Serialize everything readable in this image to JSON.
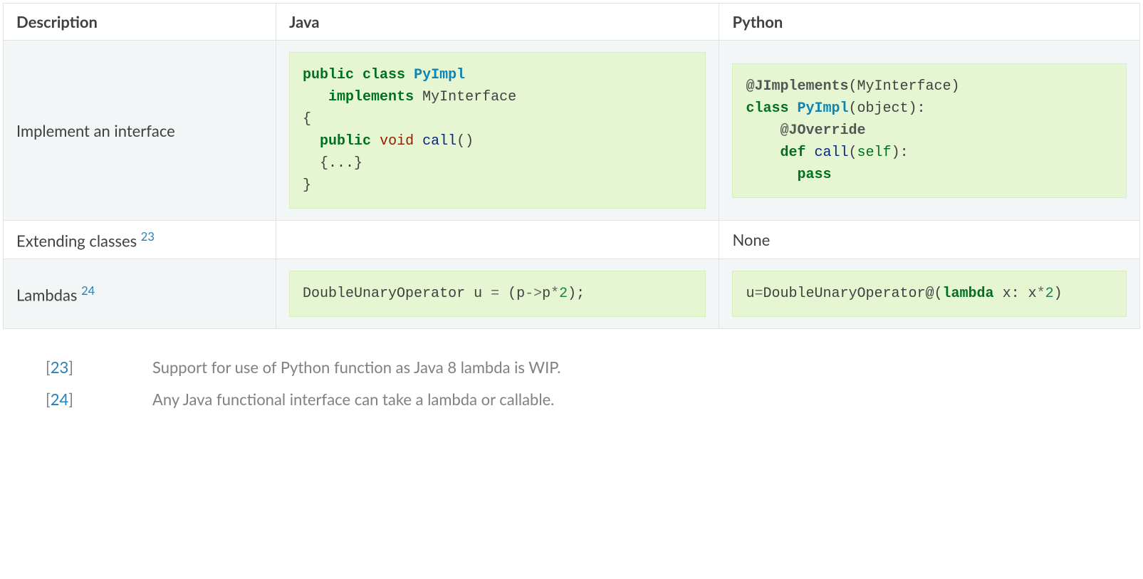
{
  "headers": {
    "description": "Description",
    "java": "Java",
    "python": "Python"
  },
  "rows": {
    "implement": {
      "desc": "Implement an interface",
      "java_code": {
        "line1_kd": "public class ",
        "line1_nc": "PyImpl",
        "line2_indent": "   ",
        "line2_kd": "implements",
        "line2_n": " MyInterface",
        "line3": "{",
        "line4_indent": "  ",
        "line4_kd": "public",
        "line4_sp": " ",
        "line4_kt": "void",
        "line4_sp2": " ",
        "line4_nf": "call",
        "line4_p": "()",
        "line5_indent": "  ",
        "line5": "{...}",
        "line6": "}"
      },
      "python_code": {
        "line1_nd": "@JImplements",
        "line1_p": "(MyInterface)",
        "line2_k": "class",
        "line2_sp": " ",
        "line2_nc": "PyImpl",
        "line2_p": "(object):",
        "line3_indent": "    ",
        "line3_nd": "@JOverride",
        "line4_indent": "    ",
        "line4_k": "def",
        "line4_sp": " ",
        "line4_nf": "call",
        "line4_p1": "(",
        "line4_bp": "self",
        "line4_p2": "):",
        "line5_indent": "      ",
        "line5_k": "pass"
      }
    },
    "extending": {
      "desc_text": "Extending classes ",
      "desc_ref": "23",
      "java": "",
      "python": "None"
    },
    "lambdas": {
      "desc_text": "Lambdas ",
      "desc_ref": "24",
      "java_code": {
        "t1": "DoubleUnaryOperator u ",
        "o1": "=",
        "t2": " (p",
        "o2": "->",
        "t3": "p",
        "o3": "*",
        "m1": "2",
        "t4": ");"
      },
      "python_code": {
        "t1": "u",
        "o1": "=",
        "t2": "DoubleUnaryOperator@(",
        "k1": "lambda",
        "t3": " x: x",
        "o2": "*",
        "m1": "2",
        "t4": ")"
      }
    }
  },
  "footnotes": {
    "fn23": {
      "num": "23",
      "text": "Support for use of Python function as Java 8 lambda is WIP."
    },
    "fn24": {
      "num": "24",
      "text": "Any Java functional interface can take a lambda or callable."
    }
  }
}
